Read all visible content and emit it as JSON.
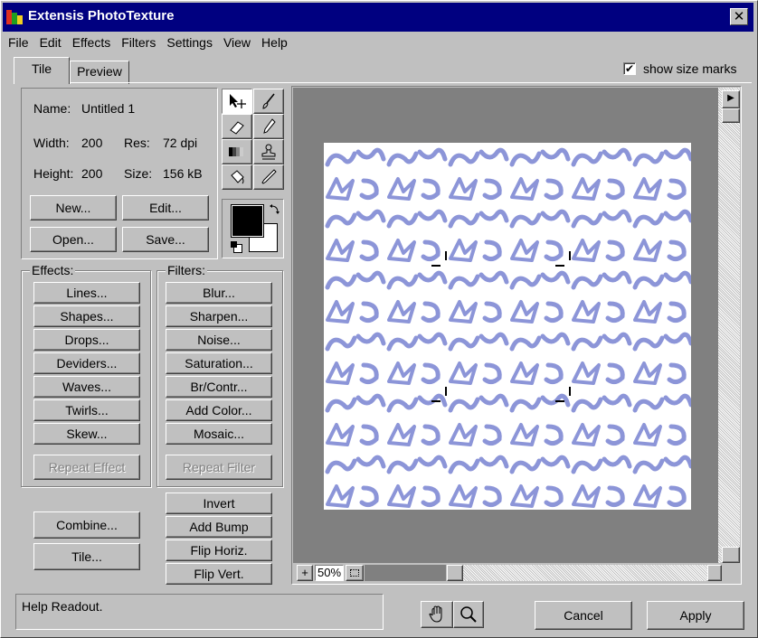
{
  "window": {
    "title": "Extensis PhotoTexture"
  },
  "menu": [
    "File",
    "Edit",
    "Effects",
    "Filters",
    "Settings",
    "View",
    "Help"
  ],
  "tabs": [
    {
      "label": "Tile",
      "active": true
    },
    {
      "label": "Preview",
      "active": false
    }
  ],
  "show_size_marks": {
    "label": "show size marks",
    "checked": true
  },
  "info": {
    "name_label": "Name:",
    "name_value": "Untitled 1",
    "width_label": "Width:",
    "width_value": "200",
    "res_label": "Res:",
    "res_value": "72 dpi",
    "height_label": "Height:",
    "height_value": "200",
    "size_label": "Size:",
    "size_value": "156 kB"
  },
  "file_buttons": {
    "new": "New...",
    "edit": "Edit...",
    "open": "Open...",
    "save": "Save..."
  },
  "effects": {
    "title": "Effects:",
    "buttons": [
      "Lines...",
      "Shapes...",
      "Drops...",
      "Deviders...",
      "Waves...",
      "Twirls...",
      "Skew..."
    ],
    "repeat": "Repeat Effect"
  },
  "filters": {
    "title": "Filters:",
    "buttons": [
      "Blur...",
      "Sharpen...",
      "Noise...",
      "Saturation...",
      "Br/Contr...",
      "Add Color...",
      "Mosaic..."
    ],
    "repeat": "Repeat Filter"
  },
  "extra_buttons": [
    "Invert",
    "Add Bump",
    "Flip Horiz.",
    "Flip Vert."
  ],
  "combine_label": "Combine...",
  "tile_label": "Tile...",
  "zoom": {
    "plus": "+",
    "value": "50%"
  },
  "help_readout": "Help Readout.",
  "actions": {
    "cancel": "Cancel",
    "apply": "Apply"
  },
  "colors": {
    "foreground": "#000000",
    "background": "#ffffff",
    "texture": "#8c95d8"
  },
  "icons": [
    "move-icon",
    "brush-icon",
    "eraser-icon",
    "pencil-icon",
    "gradient-icon",
    "stamp-icon",
    "bucket-icon",
    "eyedropper-icon",
    "swap-icon",
    "hand-icon",
    "zoom-icon"
  ]
}
